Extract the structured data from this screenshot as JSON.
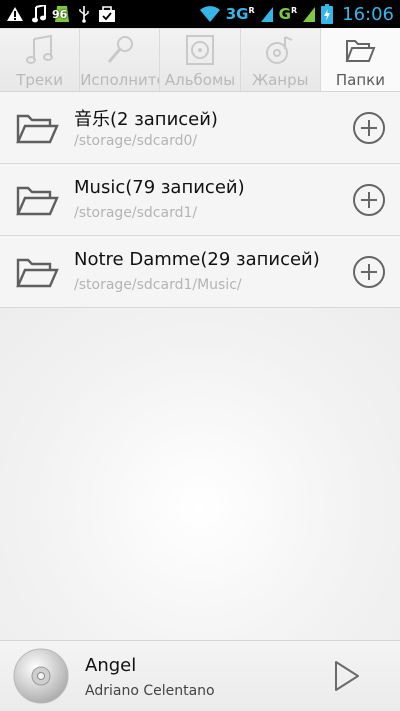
{
  "status_bar": {
    "battery_percent": "96",
    "network_3g": "3G",
    "network_g": "G",
    "roaming_mark": "R",
    "time": "16:06",
    "icons": [
      "warning-icon",
      "music-note-icon",
      "battery-badge-icon",
      "usb-icon",
      "bag-icon",
      "wifi-icon",
      "signal-icon",
      "battery-icon"
    ]
  },
  "tabs": [
    {
      "label": "Треки",
      "icon": "note-icon",
      "active": false
    },
    {
      "label": "Исполнители",
      "icon": "microphone-icon",
      "active": false
    },
    {
      "label": "Альбомы",
      "icon": "album-icon",
      "active": false
    },
    {
      "label": "Жанры",
      "icon": "genre-icon",
      "active": false
    },
    {
      "label": "Папки",
      "icon": "folder-icon",
      "active": true
    }
  ],
  "folders": [
    {
      "title": "音乐(2 записей)",
      "path": "/storage/sdcard0/"
    },
    {
      "title": "Music(79 записей)",
      "path": "/storage/sdcard1/"
    },
    {
      "title": "Notre Damme(29 записей)",
      "path": "/storage/sdcard1/Music/"
    }
  ],
  "now_playing": {
    "title": "Angel",
    "artist": "Adriano Celentano"
  },
  "colors": {
    "accent": "#35b6e6",
    "signal_green": "#7fc942",
    "icon_gray": "#5f5f5f",
    "inactive_gray": "#b9b9b9"
  }
}
